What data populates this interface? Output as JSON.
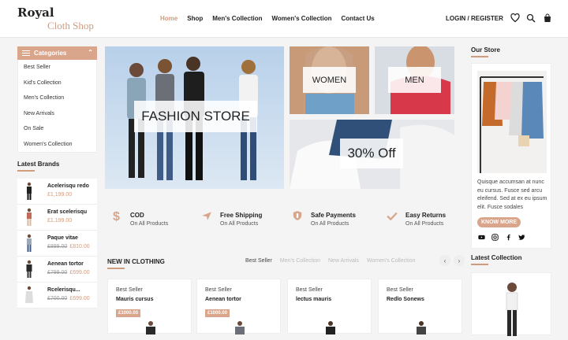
{
  "brand": {
    "line1": "Royal",
    "line2": "Cloth Shop"
  },
  "nav": [
    {
      "label": "Home",
      "active": true
    },
    {
      "label": "Shop",
      "active": false
    },
    {
      "label": "Men's Collection",
      "active": false
    },
    {
      "label": "Women's Collection",
      "active": false
    },
    {
      "label": "Contact Us",
      "active": false
    }
  ],
  "header": {
    "login_label": "LOGIN / REGISTER",
    "icons": [
      "heart-icon",
      "search-icon",
      "shopping-bag-icon"
    ]
  },
  "sidebar": {
    "categories_title": "Categories",
    "categories": [
      "Best Seller",
      "Kid's Collection",
      "Men's Collection",
      "New Arrivals",
      "On Sale",
      "Women's Collection"
    ],
    "brands_title": "Latest Brands",
    "brands": [
      {
        "name": "Acelerisqu redo",
        "old_price": "",
        "price": "£1,199.00"
      },
      {
        "name": "Erat scelerisqu",
        "old_price": "",
        "price": "£1,199.00"
      },
      {
        "name": "Paque vitae",
        "old_price": "£899.00",
        "price": "£810.00"
      },
      {
        "name": "Aenean tortor",
        "old_price": "£799.00",
        "price": "£699.00"
      },
      {
        "name": "Rcelerisqu...",
        "old_price": "£700.00",
        "price": "£699.00"
      }
    ]
  },
  "banners": {
    "hero": "FASHION STORE",
    "women": "WOMEN",
    "men": "MEN",
    "offer": "30% Off"
  },
  "features": [
    {
      "icon": "dollar-icon",
      "title": "COD",
      "subtitle": "On All Products"
    },
    {
      "icon": "airplane-icon",
      "title": "Free Shipping",
      "subtitle": "On All Products"
    },
    {
      "icon": "shield-icon",
      "title": "Safe Payments",
      "subtitle": "On All Products"
    },
    {
      "icon": "checkmark-icon",
      "title": "Easy Returns",
      "subtitle": "On All Products"
    }
  ],
  "new_in": {
    "title": "NEW IN CLOTHING",
    "tabs": [
      "Best Seller",
      "Men's Collection",
      "New Arrivals",
      "Women's Collection"
    ],
    "active_tab": "Best Seller",
    "products": [
      {
        "label": "Best Seller",
        "name": "Mauris cursus",
        "price": "£1000.00"
      },
      {
        "label": "Best Seller",
        "name": "Aenean tortor",
        "price": "£1000.00"
      },
      {
        "label": "Best Seller",
        "name": "lectus mauris",
        "price": ""
      },
      {
        "label": "Best Seller",
        "name": "Redlo Sonews",
        "price": ""
      }
    ]
  },
  "store": {
    "title": "Our Store",
    "text": "Quisque accumsan at nunc eu cursus. Fusce sed arcu eleifend. Sed at ex eu ipsum elit. Fusce sodales",
    "button": "KNOW MORE",
    "social": [
      "youtube-icon",
      "instagram-icon",
      "facebook-icon",
      "twitter-icon"
    ]
  },
  "latest_collection": {
    "title": "Latest Collection"
  },
  "colors": {
    "accent": "#d19b7e",
    "accent_bg": "#d9a58b",
    "page_bg": "#f4f4f4"
  }
}
